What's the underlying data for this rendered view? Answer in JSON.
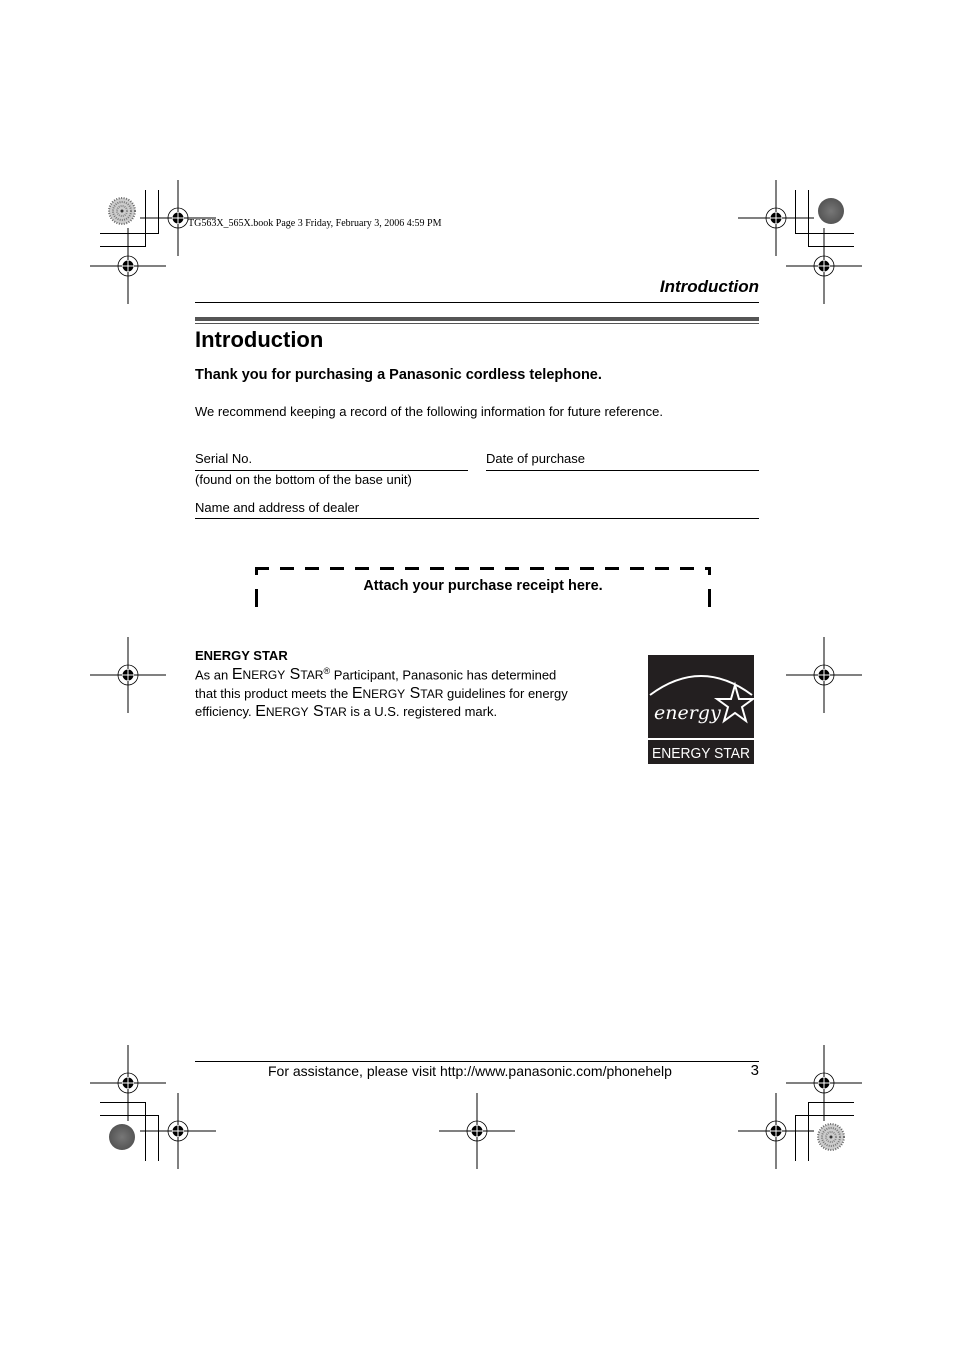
{
  "slug": "TG563X_565X.book  Page 3  Friday, February 3, 2006  4:59 PM",
  "running_head": "Introduction",
  "title": "Introduction",
  "lead": "Thank you for purchasing a Panasonic cordless telephone.",
  "recommend": "We recommend keeping a record of the following information for future reference.",
  "form": {
    "serial_label": "Serial No.",
    "serial_note": "(found on the bottom of the base unit)",
    "date_label": "Date of purchase",
    "dealer_label": "Name and address of dealer"
  },
  "receipt": "Attach your purchase receipt here.",
  "energy_star": {
    "heading": "ENERGY STAR",
    "line1_pre": "As an ",
    "brand_E": "E",
    "brand_NERGY": "NERGY",
    "brand_S": "S",
    "brand_TAR": "TAR",
    "reg": "®",
    "line1_post": " Participant, Panasonic has determined",
    "line2_pre": "that this product meets the ",
    "line2_post": " guidelines for energy",
    "line3_pre": "efficiency. ",
    "line3_post": " is a U.S. registered mark.",
    "logo_script": "energy",
    "logo_label": "ENERGY STAR"
  },
  "footer": {
    "assist": "For assistance, please visit http://www.panasonic.com/phonehelp",
    "page_number": "3"
  }
}
